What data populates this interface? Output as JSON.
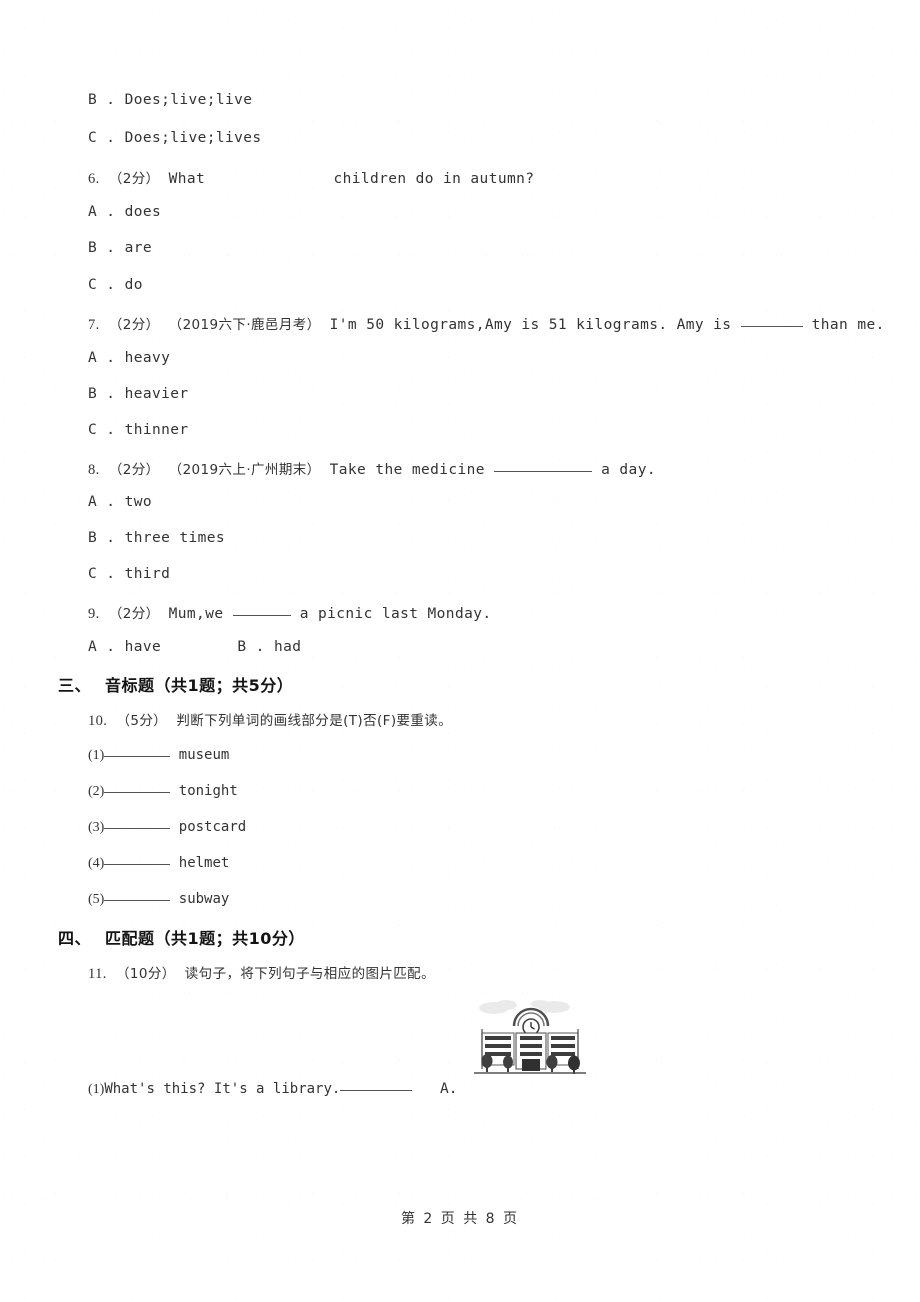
{
  "document": {
    "paper_width": 920,
    "paper_height": 1302,
    "footer": "第 2 页 共 8 页"
  },
  "continued_options": [
    {
      "letter": "B",
      "sep": ".",
      "text": "Does;live;live"
    },
    {
      "letter": "C",
      "sep": ".",
      "text": "Does;live;lives"
    }
  ],
  "questions": [
    {
      "number": "6.",
      "score": "（2分）",
      "source": "",
      "stem_before": "What",
      "blank_type": "gap",
      "blank_width": 110,
      "stem_after": "children do in autumn?",
      "options": [
        {
          "letter": "A",
          "sep": ".",
          "text": "does"
        },
        {
          "letter": "B",
          "sep": ".",
          "text": "are"
        },
        {
          "letter": "C",
          "sep": ".",
          "text": "do"
        }
      ]
    },
    {
      "number": "7.",
      "score": "（2分）",
      "source": "（2019六下·鹿邑月考）",
      "stem_before": "I'm 50 kilograms,Amy is 51 kilograms.  Amy is",
      "blank_type": "underline",
      "blank_width": 62,
      "stem_after": "than me.",
      "options": [
        {
          "letter": "A",
          "sep": ".",
          "text": "heavy"
        },
        {
          "letter": "B",
          "sep": ".",
          "text": "heavier"
        },
        {
          "letter": "C",
          "sep": ".",
          "text": "thinner"
        }
      ]
    },
    {
      "number": "8.",
      "score": "（2分）",
      "source": "（2019六上·广州期末）",
      "stem_before": "Take the medicine",
      "blank_type": "underline",
      "blank_width": 98,
      "stem_after": "a day.",
      "options": [
        {
          "letter": "A",
          "sep": ".",
          "text": "two"
        },
        {
          "letter": "B",
          "sep": ".",
          "text": "three times"
        },
        {
          "letter": "C",
          "sep": ".",
          "text": "third"
        }
      ]
    },
    {
      "number": "9.",
      "score": "（2分）",
      "source": "",
      "stem_before": "Mum,we",
      "blank_type": "underline",
      "blank_width": 58,
      "stem_after": "a picnic last Monday.",
      "options_inline": [
        {
          "letter": "A",
          "sep": ".",
          "text": "have"
        },
        {
          "letter": "B",
          "sep": ".",
          "text": "had"
        }
      ]
    }
  ],
  "section_three": {
    "index": "三、",
    "title": "音标题（共1题；共5分）",
    "question": {
      "number": "10.",
      "score": "（5分）",
      "prompt": "判断下列单词的画线部分是(T)否(F)要重读。"
    },
    "items": [
      {
        "index": "(1)",
        "word": "museum"
      },
      {
        "index": "(2)",
        "word": "tonight"
      },
      {
        "index": "(3)",
        "word": "postcard"
      },
      {
        "index": "(4)",
        "word": "helmet"
      },
      {
        "index": "(5)",
        "word": "subway"
      }
    ]
  },
  "section_four": {
    "index": "四、",
    "title": "匹配题（共1题；共10分）",
    "question": {
      "number": "11.",
      "score": "（10分）",
      "prompt": "读句子，将下列句子与相应的图片匹配。"
    },
    "match_items": [
      {
        "index": "(1)",
        "sentence": "What's this? It's a library.",
        "answer_blank": true,
        "picture_label": "A.",
        "picture_name": "library-building-illustration"
      }
    ]
  }
}
